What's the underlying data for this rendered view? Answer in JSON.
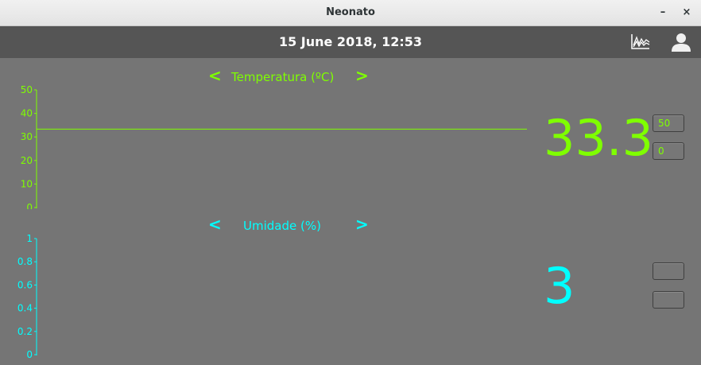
{
  "window": {
    "title": "Neonato",
    "minimize_label": "–",
    "close_label": "×"
  },
  "header": {
    "datetime": "15 June 2018, 12:53",
    "chart_icon": "chart-icon",
    "user_icon": "user-icon"
  },
  "temperature": {
    "title": "Temperatura (ºC)",
    "prev_label": "<",
    "next_label": ">",
    "value": "33.3",
    "upper_limit": "50",
    "lower_limit": "0",
    "color": "#7fff00"
  },
  "humidity": {
    "title": "Umidade (%)",
    "prev_label": "<",
    "next_label": ">",
    "value": "3",
    "upper_limit": "",
    "lower_limit": "",
    "color": "#00ffff"
  },
  "chart_data": [
    {
      "type": "line",
      "title": "Temperatura (ºC)",
      "ylim": [
        0,
        50
      ],
      "yticks": [
        "50",
        "40",
        "30",
        "20",
        "10",
        "0"
      ],
      "series": [
        {
          "values": [
            33.3,
            33.3
          ]
        }
      ]
    },
    {
      "type": "line",
      "title": "Umidade (%)",
      "ylim": [
        0,
        1
      ],
      "yticks": [
        "1",
        "0.8",
        "0.6",
        "0.4",
        "0.2",
        "0"
      ],
      "series": []
    }
  ]
}
